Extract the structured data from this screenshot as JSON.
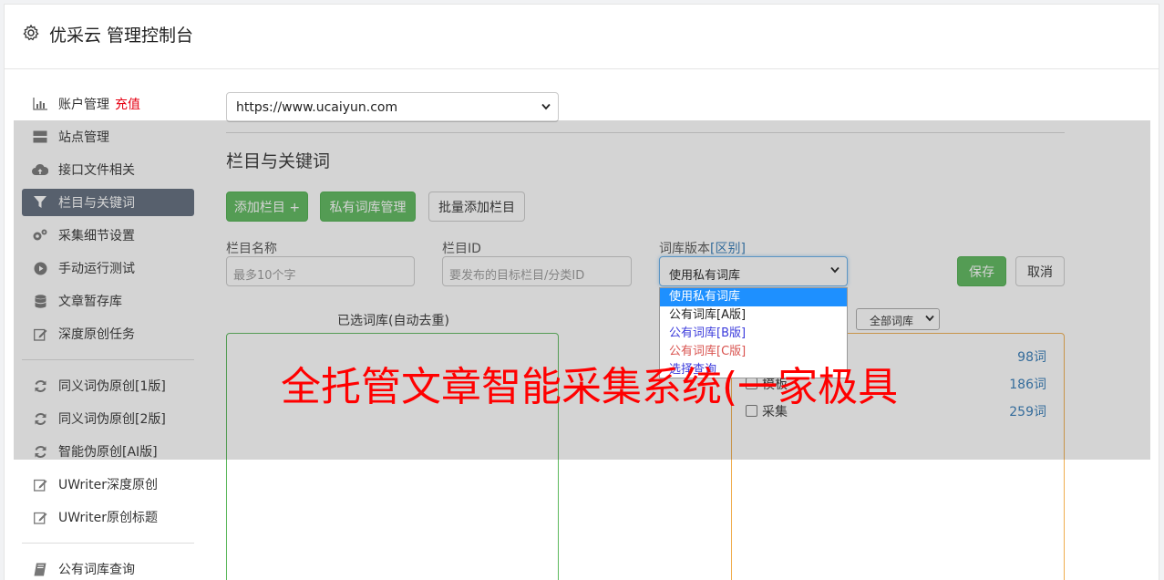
{
  "header": {
    "title": "优采云 管理控制台",
    "icon": "gear-icon"
  },
  "sidebar": {
    "items": [
      {
        "label": "账户管理",
        "badge": "充值",
        "icon": "bar-chart-icon"
      },
      {
        "label": "站点管理",
        "icon": "server-icon"
      },
      {
        "label": "接口文件相关",
        "icon": "cloud-upload-icon"
      },
      {
        "label": "栏目与关键词",
        "icon": "filter-icon",
        "active": true
      },
      {
        "label": "采集细节设置",
        "icon": "cogs-icon"
      },
      {
        "label": "手动运行测试",
        "icon": "play-circle-icon"
      },
      {
        "label": "文章暂存库",
        "icon": "database-icon"
      },
      {
        "label": "深度原创任务",
        "icon": "edit-icon"
      },
      {
        "label": "同义词伪原创[1版]",
        "icon": "refresh-icon"
      },
      {
        "label": "同义词伪原创[2版]",
        "icon": "refresh-icon"
      },
      {
        "label": "智能伪原创[AI版]",
        "icon": "refresh-icon"
      },
      {
        "label": "UWriter深度原创",
        "icon": "edit-icon"
      },
      {
        "label": "UWriter原创标题",
        "icon": "edit-icon"
      },
      {
        "label": "公有词库查询",
        "icon": "book-icon"
      }
    ]
  },
  "site_select": {
    "value": "https://www.ucaiyun.com"
  },
  "section": {
    "title": "栏目与关键词"
  },
  "toolbar": {
    "add_column": "添加栏目 +",
    "private_lib": "私有词库管理",
    "batch_add": "批量添加栏目"
  },
  "form": {
    "column_name_label": "栏目名称",
    "column_name_placeholder": "最多10个字",
    "column_id_label": "栏目ID",
    "column_id_placeholder": "要发布的目标栏目/分类ID",
    "lib_version_label": "词库版本",
    "lib_version_link": "[区别]",
    "lib_version_value": "使用私有词库",
    "save": "保存",
    "cancel": "取消"
  },
  "dropdown": {
    "options": [
      "使用私有词库",
      "公有词库[A版]",
      "公有词库[B版]",
      "公有词库[C版]",
      "选择查询"
    ]
  },
  "selected_libs": {
    "title": "已选词库(自动去重)"
  },
  "all_libs": {
    "filter_value": "全部词库",
    "rows": [
      {
        "name": "",
        "count": "98词"
      },
      {
        "name": "模板",
        "count": "186词"
      },
      {
        "name": "采集",
        "count": "259词"
      }
    ]
  },
  "banner": {
    "text": "全托管文章智能采集系统(一家极具"
  },
  "colors": {
    "primary_green": "#5cb85c",
    "active_nav": "#5f6b7c",
    "recharge_red": "#e60012",
    "banner_red": "#ff0000",
    "option_blue": "#3c3cdc",
    "option_red": "#d9534f"
  }
}
